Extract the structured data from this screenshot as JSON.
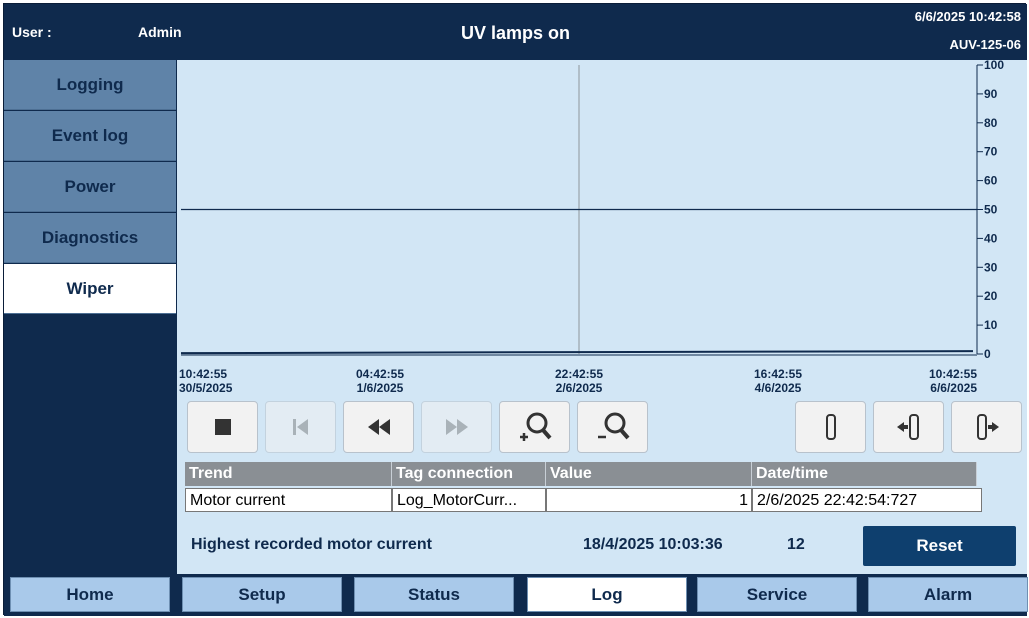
{
  "header": {
    "user_label": "User :",
    "user_name": "Admin",
    "status_title": "UV lamps on",
    "datetime": "6/6/2025 10:42:58",
    "device_id": "AUV-125-06"
  },
  "sidebar": {
    "items": [
      {
        "label": "Logging",
        "active": false
      },
      {
        "label": "Event log",
        "active": false
      },
      {
        "label": "Power",
        "active": false
      },
      {
        "label": "Diagnostics",
        "active": false
      },
      {
        "label": "Wiper",
        "active": true
      }
    ]
  },
  "trend": {
    "y_ticks": [
      "100",
      "90",
      "80",
      "70",
      "60",
      "50",
      "40",
      "30",
      "20",
      "10",
      "0"
    ],
    "x_ticks": [
      {
        "time": "10:42:55",
        "date": "30/5/2025"
      },
      {
        "time": "04:42:55",
        "date": "1/6/2025"
      },
      {
        "time": "22:42:55",
        "date": "2/6/2025"
      },
      {
        "time": "16:42:55",
        "date": "4/6/2025"
      },
      {
        "time": "10:42:55",
        "date": "6/6/2025"
      }
    ],
    "cursor_position": 0.5,
    "horizontal_line_value": 50,
    "plotted_value": 0.3,
    "line_color": "#0f2a4d"
  },
  "toolbar": {
    "buttons": [
      {
        "icon": "stop-icon",
        "enabled": true
      },
      {
        "icon": "first-icon",
        "enabled": false
      },
      {
        "icon": "rewind-icon",
        "enabled": true
      },
      {
        "icon": "forward-icon",
        "enabled": false
      },
      {
        "icon": "zoom-in-icon",
        "enabled": true
      },
      {
        "icon": "zoom-out-icon",
        "enabled": true
      },
      {
        "icon": "ruler-icon",
        "enabled": true
      },
      {
        "icon": "ruler-left-icon",
        "enabled": true
      },
      {
        "icon": "ruler-right-icon",
        "enabled": true
      }
    ]
  },
  "table": {
    "headers": [
      "Trend",
      "Tag connection",
      "Value",
      "Date/time"
    ],
    "row": {
      "trend": "Motor current",
      "tag": "Log_MotorCurr...",
      "value": "1",
      "datetime": "2/6/2025 22:42:54:727"
    }
  },
  "max_record": {
    "label": "Highest recorded motor current",
    "date": "18/4/2025 10:03:36",
    "value": "12",
    "reset_label": "Reset"
  },
  "bottom_nav": {
    "items": [
      {
        "label": "Home",
        "active": false
      },
      {
        "label": "Setup",
        "active": false
      },
      {
        "label": "Status",
        "active": false
      },
      {
        "label": "Log",
        "active": true
      },
      {
        "label": "Service",
        "active": false
      },
      {
        "label": "Alarm",
        "active": false
      }
    ]
  },
  "colors": {
    "header_bg": "#0f2a4d",
    "panel_bg": "#d2e6f5",
    "accent_button": "#0e3f6e"
  }
}
